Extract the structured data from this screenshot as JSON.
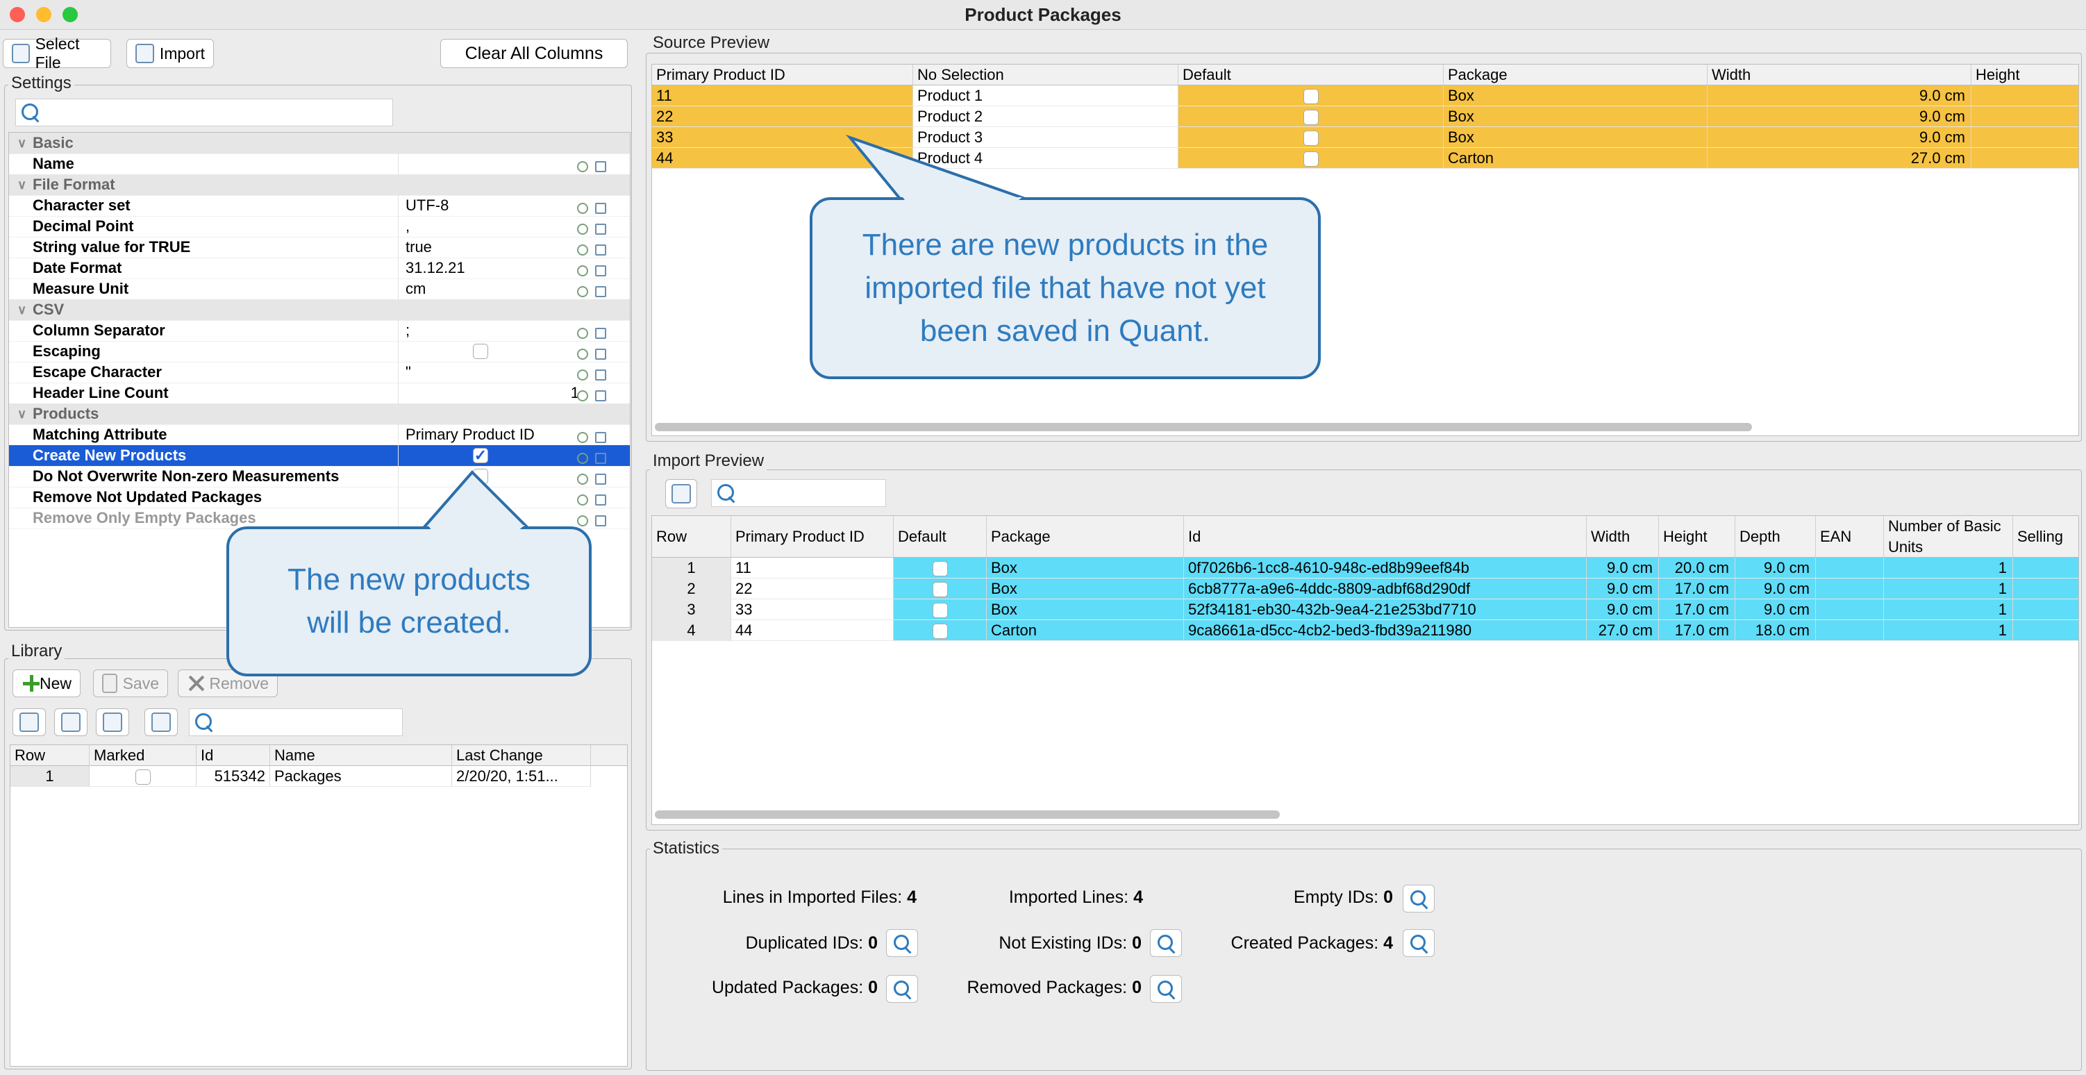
{
  "window": {
    "title": "Product Packages"
  },
  "toolbar": {
    "select_file": "Select File",
    "import": "Import",
    "clear_all": "Clear All Columns"
  },
  "settings": {
    "title": "Settings",
    "rows": [
      {
        "label": "Basic",
        "value": "",
        "category": true
      },
      {
        "label": "Name",
        "value": ""
      },
      {
        "label": "File Format",
        "value": "",
        "category": true
      },
      {
        "label": "Character set",
        "value": "UTF-8"
      },
      {
        "label": "Decimal Point",
        "value": ","
      },
      {
        "label": "String value for TRUE",
        "value": "true"
      },
      {
        "label": "Date Format",
        "value": "31.12.21"
      },
      {
        "label": "Measure Unit",
        "value": "cm"
      },
      {
        "label": "CSV",
        "value": "",
        "category": true
      },
      {
        "label": "Column Separator",
        "value": ";"
      },
      {
        "label": "Escaping",
        "value": ""
      },
      {
        "label": "Escape Character",
        "value": "\""
      },
      {
        "label": "Header Line Count",
        "value": "1"
      },
      {
        "label": "Products",
        "value": "",
        "category": true
      },
      {
        "label": "Matching Attribute",
        "value": "Primary Product ID"
      },
      {
        "label": "Create New Products",
        "value": ""
      },
      {
        "label": "Do Not Overwrite Non-zero Measurements",
        "value": ""
      },
      {
        "label": "Remove Not Updated Packages",
        "value": ""
      },
      {
        "label": "Remove Only Empty Packages",
        "value": ""
      }
    ]
  },
  "library": {
    "title": "Library",
    "new": "New",
    "save": "Save",
    "remove": "Remove",
    "columns": [
      "Row",
      "Marked",
      "Id",
      "Name",
      "Last Change"
    ],
    "rows": [
      {
        "row": "1",
        "id": "515342",
        "name": "Packages",
        "last_change": "2/20/20, 1:51..."
      }
    ]
  },
  "source_preview": {
    "title": "Source Preview",
    "columns": [
      "Primary Product ID",
      "No Selection",
      "Default",
      "Package",
      "Width",
      "Height"
    ],
    "rows": [
      {
        "id": "11",
        "product": "Product 1",
        "package": "Box",
        "width": "9.0 cm"
      },
      {
        "id": "22",
        "product": "Product 2",
        "package": "Box",
        "width": "9.0 cm"
      },
      {
        "id": "33",
        "product": "Product 3",
        "package": "Box",
        "width": "9.0 cm"
      },
      {
        "id": "44",
        "product": "Product 4",
        "package": "Carton",
        "width": "27.0 cm"
      }
    ]
  },
  "import_preview": {
    "title": "Import Preview",
    "columns": [
      "Row",
      "Primary Product ID",
      "Default",
      "Package",
      "Id",
      "Width",
      "Height",
      "Depth",
      "EAN",
      "Number of Basic Units",
      "Selling"
    ],
    "rows": [
      {
        "row": "1",
        "pid": "11",
        "package": "Box",
        "id": "0f7026b6-1cc8-4610-948c-ed8b99eef84b",
        "width": "9.0 cm",
        "height": "20.0 cm",
        "depth": "9.0 cm",
        "units": "1"
      },
      {
        "row": "2",
        "pid": "22",
        "package": "Box",
        "id": "6cb8777a-a9e6-4ddc-8809-adbf68d290df",
        "width": "9.0 cm",
        "height": "17.0 cm",
        "depth": "9.0 cm",
        "units": "1"
      },
      {
        "row": "3",
        "pid": "33",
        "package": "Box",
        "id": "52f34181-eb30-432b-9ea4-21e253bd7710",
        "width": "9.0 cm",
        "height": "17.0 cm",
        "depth": "9.0 cm",
        "units": "1"
      },
      {
        "row": "4",
        "pid": "44",
        "package": "Carton",
        "id": "9ca8661a-d5cc-4cb2-bed3-fbd39a211980",
        "width": "27.0 cm",
        "height": "17.0 cm",
        "depth": "18.0 cm",
        "units": "1"
      }
    ]
  },
  "statistics": {
    "title": "Statistics",
    "lines_imported_files": {
      "label": "Lines in Imported Files:",
      "value": "4"
    },
    "imported_lines": {
      "label": "Imported Lines:",
      "value": "4"
    },
    "empty_ids": {
      "label": "Empty IDs:",
      "value": "0"
    },
    "duplicated_ids": {
      "label": "Duplicated IDs:",
      "value": "0"
    },
    "not_existing_ids": {
      "label": "Not Existing IDs:",
      "value": "0"
    },
    "created_packages": {
      "label": "Created Packages:",
      "value": "4"
    },
    "updated_packages": {
      "label": "Updated Packages:",
      "value": "0"
    },
    "removed_packages": {
      "label": "Removed Packages:",
      "value": "0"
    }
  },
  "callouts": {
    "new_products": "There are new products in the imported file that have not yet been saved in Quant.",
    "will_create": "The new products will be created."
  },
  "colors": {
    "source_highlight": "#f6c242",
    "import_highlight": "#5fdcf7",
    "selection": "#1a5cd6",
    "callout_text": "#2e7bbf"
  }
}
